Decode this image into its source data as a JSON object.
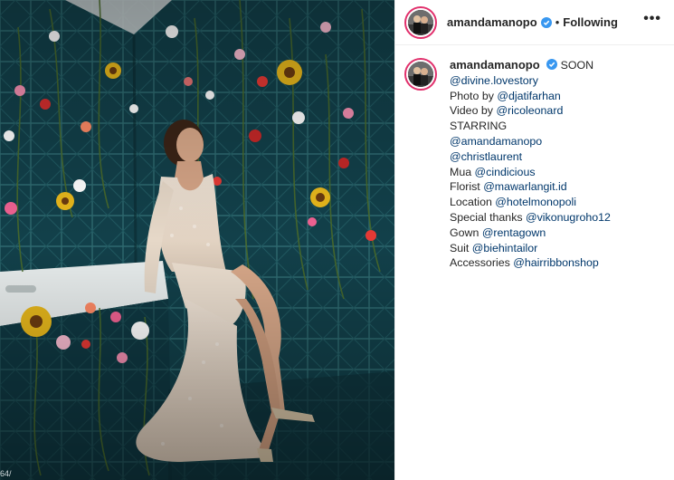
{
  "photo": {
    "counter": "64/"
  },
  "header": {
    "username": "amandamanopo",
    "separator": "•",
    "follow_status": "Following",
    "more_label": "•••"
  },
  "caption": {
    "username": "amandamanopo",
    "first_text": "SOON",
    "lines": [
      {
        "prefix": "",
        "mention": "@divine.lovestory"
      },
      {
        "prefix": "Photo by ",
        "mention": "@djatifarhan"
      },
      {
        "prefix": "Video by ",
        "mention": "@ricoleonard"
      },
      {
        "prefix": "STARRING",
        "mention": ""
      },
      {
        "prefix": "",
        "mention": "@amandamanopo"
      },
      {
        "prefix": "",
        "mention": "@christlaurent"
      },
      {
        "prefix": "Mua ",
        "mention": "@cindicious"
      },
      {
        "prefix": "Florist ",
        "mention": "@mawarlangit.id"
      },
      {
        "prefix": "Location ",
        "mention": "@hotelmonopoli"
      },
      {
        "prefix": "Special thanks ",
        "mention": "@vikonugroho12"
      },
      {
        "prefix": "Gown ",
        "mention": "@rentagown"
      },
      {
        "prefix": "Suit ",
        "mention": "@biehintailor"
      },
      {
        "prefix": "Accessories ",
        "mention": "@hairribbonshop"
      }
    ]
  },
  "colors": {
    "tile": "#12404a",
    "grout": "#2e6a70",
    "link": "#00376b",
    "verified": "#3897f0",
    "story_ring": "#e1306c"
  }
}
